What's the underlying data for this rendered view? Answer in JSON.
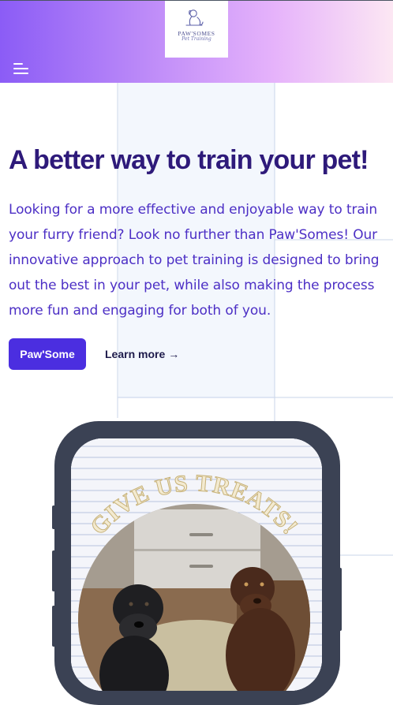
{
  "header": {
    "logo": {
      "title": "PAW'SOMES",
      "subtitle": "Pet Training"
    },
    "menu_icon": "hamburger-menu-icon",
    "gradient": [
      "#8b5cf6",
      "#c794f9",
      "#fce7f3"
    ]
  },
  "hero": {
    "title": "A better way to train your pet!",
    "description": "Looking for a more effective and enjoyable way to train your furry friend? Look no further than Paw'Somes! Our innovative approach to pet training is designed to bring out the best in your pet, while also making the process more fun and engaging for both of you.",
    "primary_button": "Paw'Some",
    "secondary_link": "Learn more",
    "secondary_arrow": "→"
  },
  "phone_image": {
    "banner_text": "GIVE US TREATS!"
  },
  "colors": {
    "accent": "#4b2ee0",
    "title": "#2e1a7a",
    "text": "#4c2fc5",
    "phone_frame": "#3b4254"
  }
}
